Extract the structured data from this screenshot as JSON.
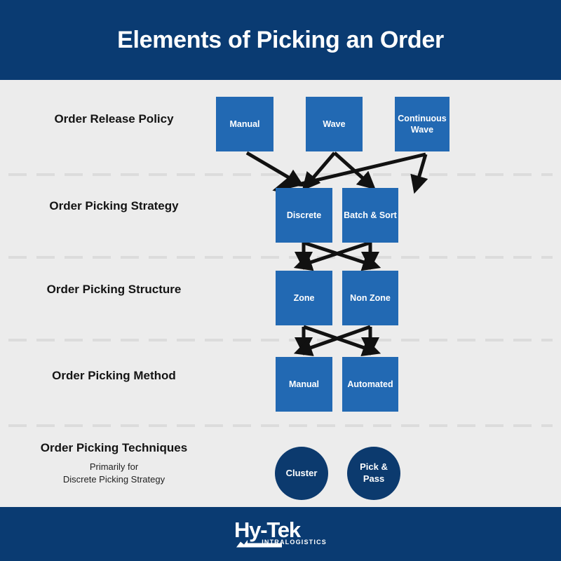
{
  "header": {
    "title": "Elements of Picking an Order",
    "bg_color": "#0a3b72",
    "text_color": "#ffffff"
  },
  "theme": {
    "page_bg": "#ececec",
    "box_blue": "#2269b3",
    "circle_navy": "#0c3a6e",
    "navy": "#0a3b72",
    "divider_gray": "#dcdcdc",
    "label_black": "#141414",
    "arrow_black": "#111111"
  },
  "rows": [
    {
      "id": "order-release-policy",
      "label": "Order Release Policy",
      "sublabel": "",
      "nodes": [
        {
          "id": "manual-release",
          "label": "Manual"
        },
        {
          "id": "wave",
          "label": "Wave"
        },
        {
          "id": "continuous-wave",
          "label": "Continuous Wave"
        }
      ]
    },
    {
      "id": "order-picking-strategy",
      "label": "Order Picking Strategy",
      "sublabel": "",
      "nodes": [
        {
          "id": "discrete",
          "label": "Discrete"
        },
        {
          "id": "batch-and-sort",
          "label": "Batch & Sort"
        }
      ]
    },
    {
      "id": "order-picking-structure",
      "label": "Order Picking Structure",
      "sublabel": "",
      "nodes": [
        {
          "id": "zone",
          "label": "Zone"
        },
        {
          "id": "non-zone",
          "label": "Non Zone"
        }
      ]
    },
    {
      "id": "order-picking-method",
      "label": "Order Picking Method",
      "sublabel": "",
      "nodes": [
        {
          "id": "manual-method",
          "label": "Manual"
        },
        {
          "id": "automated",
          "label": "Automated"
        }
      ]
    },
    {
      "id": "order-picking-techniques",
      "label": "Order Picking Techniques",
      "sublabel": "Primarily for\nDiscrete Picking Strategy",
      "nodes": [
        {
          "id": "cluster",
          "label": "Cluster"
        },
        {
          "id": "pick-pass",
          "label": "Pick & Pass"
        }
      ]
    }
  ],
  "connections": [
    {
      "from": "manual-release",
      "to": "discrete"
    },
    {
      "from": "wave",
      "to": "discrete"
    },
    {
      "from": "wave",
      "to": "batch-and-sort"
    },
    {
      "from": "continuous-wave",
      "to": "discrete"
    },
    {
      "from": "continuous-wave",
      "to": "batch-and-sort"
    },
    {
      "from": "discrete",
      "to": "zone"
    },
    {
      "from": "discrete",
      "to": "non-zone"
    },
    {
      "from": "batch-and-sort",
      "to": "zone"
    },
    {
      "from": "batch-and-sort",
      "to": "non-zone"
    },
    {
      "from": "zone",
      "to": "manual-method"
    },
    {
      "from": "zone",
      "to": "automated"
    },
    {
      "from": "non-zone",
      "to": "manual-method"
    },
    {
      "from": "non-zone",
      "to": "automated"
    }
  ],
  "footer": {
    "logo_wordmark": "Hy-Tek",
    "logo_subtext": "INTRALOGISTICS"
  }
}
